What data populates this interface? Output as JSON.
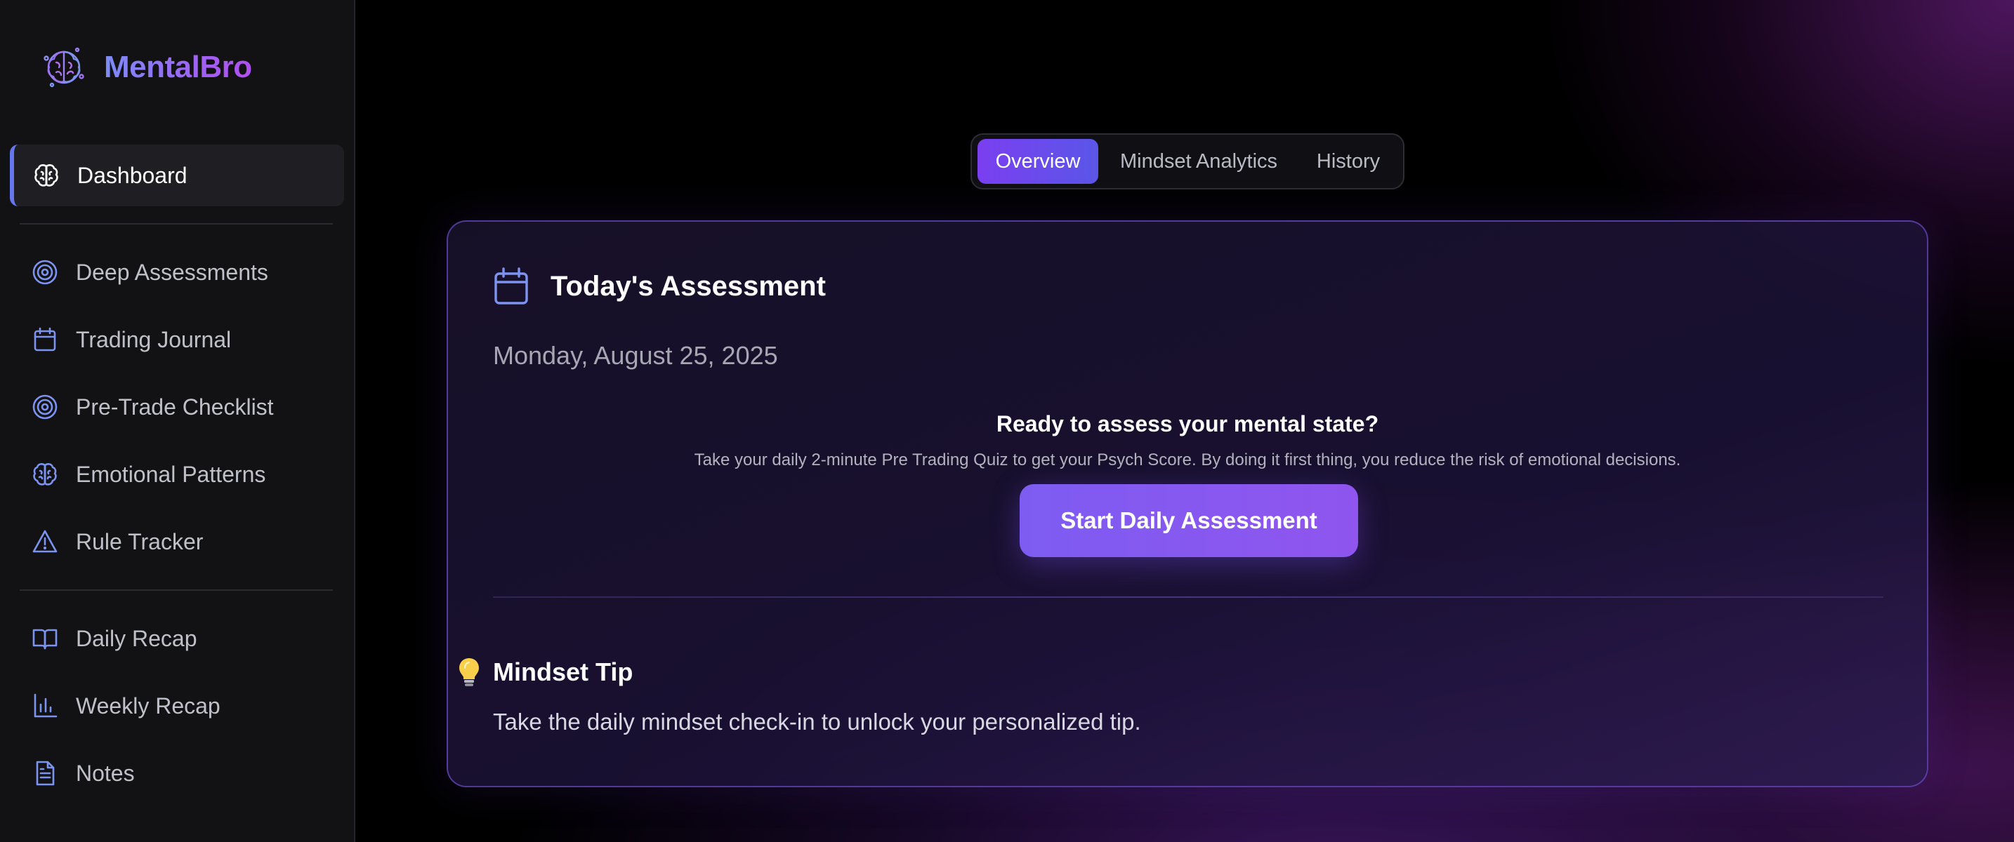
{
  "app": {
    "name": "MentalBro",
    "logo_icon": "brain-logo-icon"
  },
  "sidebar": {
    "items": [
      {
        "label": "Dashboard",
        "icon": "brain-icon",
        "active": true
      },
      {
        "label": "Deep Assessments",
        "icon": "target-icon",
        "active": false
      },
      {
        "label": "Trading Journal",
        "icon": "calendar-icon",
        "active": false
      },
      {
        "label": "Pre-Trade Checklist",
        "icon": "target-icon",
        "active": false
      },
      {
        "label": "Emotional Patterns",
        "icon": "brain-icon",
        "active": false
      },
      {
        "label": "Rule Tracker",
        "icon": "warning-triangle-icon",
        "active": false
      },
      {
        "label": "Daily Recap",
        "icon": "open-book-icon",
        "active": false
      },
      {
        "label": "Weekly Recap",
        "icon": "bar-chart-icon",
        "active": false
      },
      {
        "label": "Notes",
        "icon": "document-icon",
        "active": false
      }
    ]
  },
  "tabs": [
    {
      "label": "Overview",
      "active": true
    },
    {
      "label": "Mindset Analytics",
      "active": false
    },
    {
      "label": "History",
      "active": false
    }
  ],
  "assessment": {
    "title": "Today's Assessment",
    "icon": "calendar-icon",
    "date": "Monday, August 25, 2025",
    "cta_heading": "Ready to assess your mental state?",
    "cta_description": "Take your daily 2-minute Pre Trading Quiz to get your Psych Score. By doing it first thing, you reduce the risk of emotional decisions.",
    "cta_button": "Start Daily Assessment"
  },
  "mindset_tip": {
    "icon": "lightbulb-icon",
    "title": "Mindset Tip",
    "text": "Take the daily mindset check-in to unlock your personalized tip."
  },
  "colors": {
    "accent_purple": "#8b5cf6",
    "accent_blue": "#6677ee",
    "icon_blue": "#7c93f0",
    "sidebar_bg": "#121214"
  }
}
